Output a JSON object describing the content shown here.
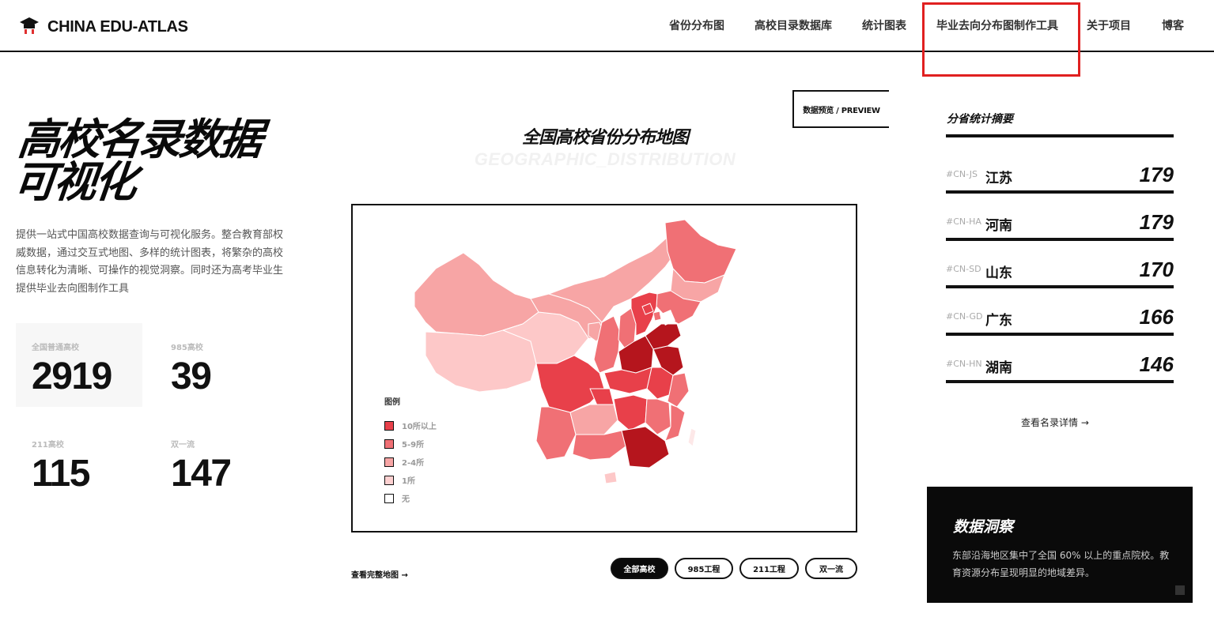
{
  "header": {
    "logo_text": "CHINA EDU-ATLAS",
    "nav": [
      "省份分布图",
      "高校目录数据库",
      "统计图表",
      "毕业去向分布图制作工具",
      "关于项目",
      "博客"
    ]
  },
  "hero": {
    "title": "高校名录数据可视化",
    "description": "提供一站式中国高校数据查询与可视化服务。整合教育部权威数据，通过交互式地图、多样的统计图表，将繁杂的高校信息转化为清晰、可操作的视觉洞察。同时还为高考毕业生提供毕业去向图制作工具"
  },
  "stats": [
    {
      "label": "全国普通高校",
      "value": "2919"
    },
    {
      "label": "985高校",
      "value": "39"
    },
    {
      "label": "211高校",
      "value": "115"
    },
    {
      "label": "双一流",
      "value": "147"
    }
  ],
  "map": {
    "preview_tag": "数据预览 / PREVIEW",
    "title": "全国高校省份分布地图",
    "subtitle": "GEOGRAPHIC_DISTRIBUTION",
    "legend_title": "图例",
    "legend": [
      {
        "label": "10所以上",
        "color": "#e8404a"
      },
      {
        "label": "5-9所",
        "color": "#f07075"
      },
      {
        "label": "2-4所",
        "color": "#f7a5a5"
      },
      {
        "label": "1所",
        "color": "#fdd0d0"
      },
      {
        "label": "无",
        "color": "#ffffff"
      }
    ],
    "view_full_link": "查看完整地图 →",
    "filters": [
      "全部高校",
      "985工程",
      "211工程",
      "双一流"
    ],
    "active_filter": "全部高校"
  },
  "summary": {
    "title": "分省统计摘要",
    "rows": [
      {
        "code": "#CN-JS",
        "name": "江苏",
        "value": "179"
      },
      {
        "code": "#CN-HA",
        "name": "河南",
        "value": "179"
      },
      {
        "code": "#CN-SD",
        "name": "山东",
        "value": "170"
      },
      {
        "code": "#CN-GD",
        "name": "广东",
        "value": "166"
      },
      {
        "code": "#CN-HN",
        "name": "湖南",
        "value": "146"
      }
    ],
    "details_link": "查看名录详情 →"
  },
  "insight": {
    "title": "数据洞察",
    "body": "东部沿海地区集中了全国 60% 以上的重点院校。教育资源分布呈现明显的地域差异。"
  },
  "colors": {
    "accent": "#e02020",
    "dark": "#0a0a0a",
    "map_darkest": "#b5151d"
  }
}
